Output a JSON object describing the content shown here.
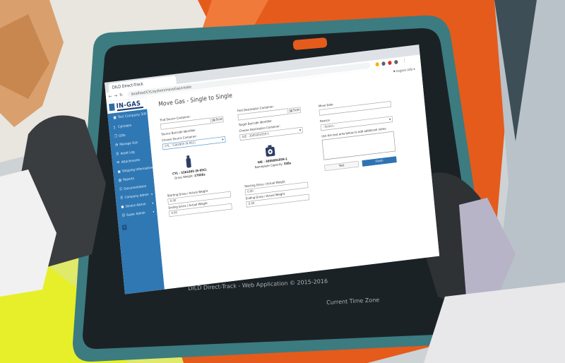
{
  "browser": {
    "tab_title": "DILD Direct-Track",
    "url": "localhost/CYL/system/moveGas/create"
  },
  "brand": {
    "logo_text": "IN-GAS"
  },
  "sidebar": {
    "company": "Test Company SIN",
    "items": [
      {
        "label": "Cylinders",
        "icon": "cylinder-icon",
        "glyph": "▯"
      },
      {
        "label": "Gifts",
        "icon": "gift-icon",
        "glyph": "❐"
      },
      {
        "label": "Manage Gas",
        "icon": "gas-icon",
        "glyph": "◔"
      },
      {
        "label": "Asset Log",
        "icon": "log-icon",
        "glyph": "☰"
      },
      {
        "label": "Attachments",
        "icon": "attachment-icon",
        "glyph": "✉"
      },
      {
        "label": "Shipping Information",
        "icon": "shipping-icon",
        "glyph": "▣"
      },
      {
        "label": "Reports",
        "icon": "reports-icon",
        "glyph": "▤"
      },
      {
        "label": "Documentation",
        "icon": "documentation-icon",
        "glyph": "☷"
      },
      {
        "label": "Company Admin",
        "icon": "company-admin-icon",
        "glyph": "☰"
      },
      {
        "label": "Device Admin",
        "icon": "device-admin-icon",
        "glyph": "●"
      },
      {
        "label": "Super Admin",
        "icon": "super-admin-icon",
        "glyph": "☺"
      }
    ]
  },
  "header": {
    "language": "English (US)"
  },
  "page": {
    "title": "Move Gas - Single to Single"
  },
  "source": {
    "find_label": "Find Source Container:",
    "find_value": "",
    "scan_label": "Scan",
    "barcode_label": "Source Barcode Identifier",
    "choose_label": "Choose Source Container:",
    "choose_value": "CYL - 5261805 (R-95C)",
    "container_name": "CYL - 5261805 (R-95C)",
    "weight_label": "Gross Weight:",
    "weight_value": "17026s",
    "starting_label": "Starting Gross / Actual Weight",
    "starting_value": "0.00",
    "ending_label": "Ending Gross / Actual Weight",
    "ending_value": "0.00"
  },
  "destination": {
    "find_label": "Find Destination Container:",
    "find_value": "",
    "scan_label": "Scan",
    "barcode_label": "Target Barcode Identifier",
    "choose_label": "Choose Destination Container:",
    "choose_value": "GIE - 3005001059-1",
    "container_name": "GIE - 3005001059-1",
    "capacity_label": "Nameplate Capacity:",
    "capacity_value": "338s",
    "starting_label": "Starting Gross / Actual Weight",
    "starting_value": "0.00",
    "ending_label": "Ending Gross / Actual Weight",
    "ending_value": "0.00"
  },
  "details": {
    "move_date_label": "Move Date",
    "move_date_value": "",
    "reason_label": "Reason",
    "reason_value": "--Select--",
    "notes_label": "Use the text area below to add additional notes:",
    "test_label": "Test",
    "finish_label": "Finish"
  },
  "footer": {
    "copyright": "DILD Direct-Track - Web Application © 2015-2016",
    "timezone": "Current Time Zone"
  },
  "colors": {
    "sidebar": "#2f78b4",
    "primary_button": "#2f73b3",
    "tablet_case": "#3a7a7e",
    "orange_background": "#e8621e",
    "high_vis_vest": "#e6ef2a"
  }
}
